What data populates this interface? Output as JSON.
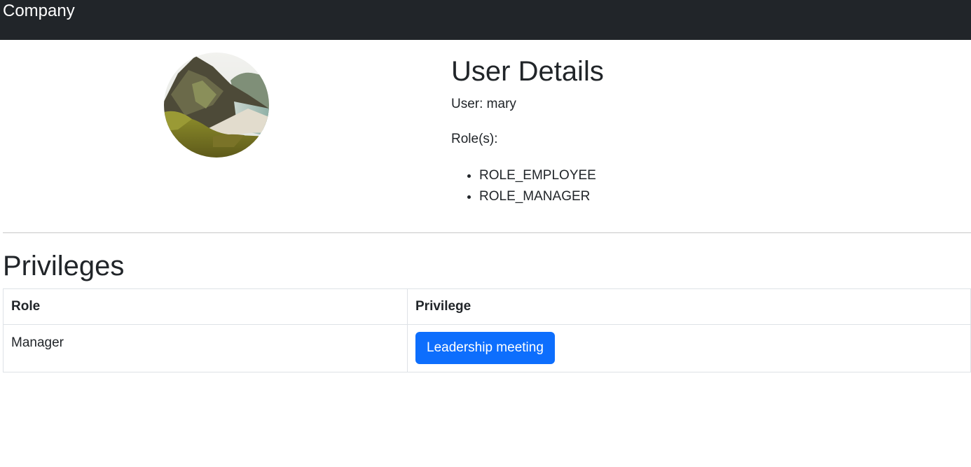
{
  "navbar": {
    "brand": "Company"
  },
  "profile": {
    "avatar_icon": "landscape-photo-icon",
    "heading": "User Details",
    "user_line": "User: mary",
    "roles_label": "Role(s):",
    "roles": [
      "ROLE_EMPLOYEE",
      "ROLE_MANAGER"
    ]
  },
  "privileges": {
    "title": "Privileges",
    "columns": [
      "Role",
      "Privilege"
    ],
    "rows": [
      {
        "role": "Manager",
        "privilege": "Leadership meeting"
      }
    ]
  },
  "colors": {
    "navbar_bg": "#212529",
    "primary": "#0d6efd",
    "text": "#212529"
  }
}
